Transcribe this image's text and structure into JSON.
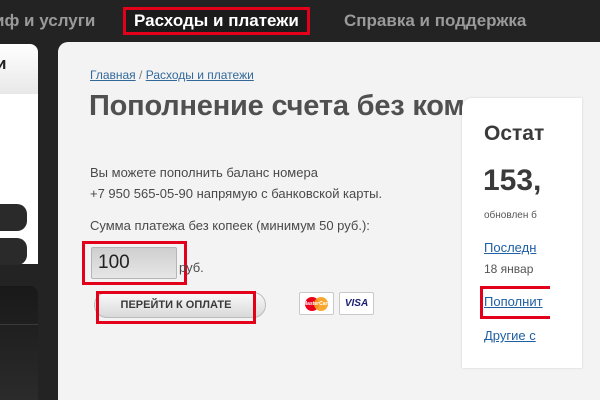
{
  "nav": {
    "tariffs": "иф и услуги",
    "payments": "Расходы и платежи",
    "support": "Справка и поддержка"
  },
  "sidebar": {
    "head_label": "и"
  },
  "breadcrumb": {
    "home": "Главная",
    "separator": "/",
    "current": "Расходы и платежи"
  },
  "page": {
    "title": "Пополнение счета без комиссии"
  },
  "form": {
    "description_line1": "Вы можете пополнить баланс номера",
    "description_line2": "+7 950 565-05-90 напрямую с банковской карты.",
    "amount_label": "Сумма платежа без копеек (минимум 50 руб.):",
    "amount_value": "100",
    "currency": "руб.",
    "pay_button": "ПЕРЕЙТИ К ОПЛАТЕ",
    "card_mastercard": "MasterCard",
    "card_visa": "VISA"
  },
  "balance": {
    "title": "Остат",
    "amount": "153,",
    "updated": "обновлен б",
    "last_link": "Последн",
    "last_date": "18 январ",
    "topup_link": "Пополнит",
    "other_link": "Другие с"
  },
  "colors": {
    "highlight": "#e2001a",
    "link": "#1f5fa3",
    "nav_bg": "#232323",
    "panel_bg": "#f3f3f3"
  }
}
